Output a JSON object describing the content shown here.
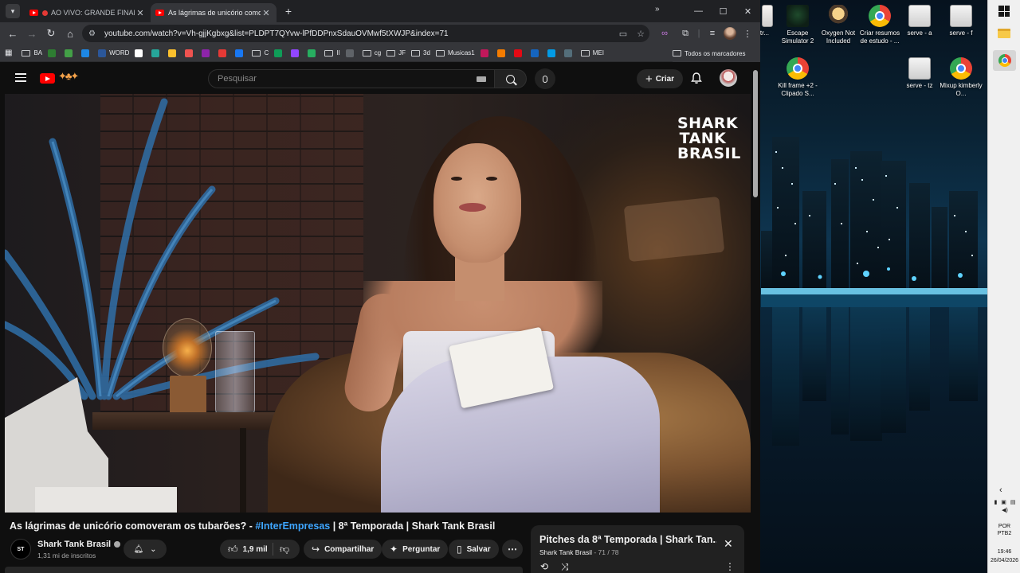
{
  "browser": {
    "tabs": [
      {
        "label": "AO VIVO: GRANDE FINAL D",
        "live": true,
        "active": false
      },
      {
        "label": "As lágrimas de unicório comove",
        "live": false,
        "active": true
      }
    ],
    "url": "youtube.com/watch?v=Vh-gjjKgbxg&list=PLDPT7QYvw-lPfDDPnxSdauOVMwf5tXWJP&index=71",
    "bookmarks": [
      {
        "label": "BA",
        "type": "folder"
      },
      {
        "label": "",
        "type": "site",
        "color": "#2e7d32"
      },
      {
        "label": "",
        "type": "site",
        "color": "#43a047"
      },
      {
        "label": "",
        "type": "site",
        "color": "#1e88e5"
      },
      {
        "label": "WORD",
        "type": "site",
        "color": "#2b579a"
      },
      {
        "label": "",
        "type": "site",
        "color": "#ffffff"
      },
      {
        "label": "",
        "type": "site",
        "color": "#26a69a"
      },
      {
        "label": "",
        "type": "site",
        "color": "#fbc02d"
      },
      {
        "label": "",
        "type": "site",
        "color": "#ef5350"
      },
      {
        "label": "",
        "type": "site",
        "color": "#8e24aa"
      },
      {
        "label": "",
        "type": "site",
        "color": "#e53935"
      },
      {
        "label": "",
        "type": "site",
        "color": "#1877f2"
      },
      {
        "label": "C",
        "type": "folder"
      },
      {
        "label": "",
        "type": "site",
        "color": "#0f9d58"
      },
      {
        "label": "",
        "type": "site",
        "color": "#9146ff"
      },
      {
        "label": "",
        "type": "site",
        "color": "#27ae60"
      },
      {
        "label": "II",
        "type": "folder"
      },
      {
        "label": "",
        "type": "site",
        "color": "#5f6368"
      },
      {
        "label": "cg",
        "type": "folder"
      },
      {
        "label": "JF",
        "type": "folder"
      },
      {
        "label": "3d",
        "type": "folder"
      },
      {
        "label": "Musicas1",
        "type": "folder"
      },
      {
        "label": "",
        "type": "site",
        "color": "#c2185b"
      },
      {
        "label": "",
        "type": "site",
        "color": "#f57c00"
      },
      {
        "label": "",
        "type": "site",
        "color": "#e50914"
      },
      {
        "label": "",
        "type": "site",
        "color": "#1565c0"
      },
      {
        "label": "",
        "type": "site",
        "color": "#039be5"
      },
      {
        "label": "",
        "type": "site",
        "color": "#546e7a"
      },
      {
        "label": "MEI",
        "type": "folder"
      }
    ],
    "all_bookmarks": "Todos os marcadores",
    "more": "»"
  },
  "youtube": {
    "search_placeholder": "Pesquisar",
    "create_label": "Criar",
    "video_overlay_logo": [
      "SHARK",
      "TANK",
      "BRASIL"
    ],
    "title_prefix": "As lágrimas de unicório comoveram os tubarões? - ",
    "title_hashtag": "#InterEmpresas",
    "title_suffix": " | 8ª Temporada | Shark Tank Brasil",
    "channel": {
      "name": "Shark Tank Brasil",
      "subscribers": "1,31 mi de inscritos",
      "avatar_text": "ST"
    },
    "actions": {
      "likes": "1,9 mil",
      "share": "Compartilhar",
      "ask": "Perguntar",
      "save": "Salvar"
    },
    "playlist": {
      "title": "Pitches da 8ª Temporada | Shark Tan...",
      "channel": "Shark Tank Brasil",
      "position": " - 71 / 78"
    }
  },
  "desktop": {
    "icons": [
      {
        "label": "d - Str...",
        "kind": "page"
      },
      {
        "label": "Escape Simulator 2",
        "kind": "escape"
      },
      {
        "label": "Oxygen Not Included",
        "kind": "oni"
      },
      {
        "label": "Criar resumos de estudo - ...",
        "kind": "chrome"
      },
      {
        "label": "serve - a",
        "kind": "page"
      },
      {
        "label": "serve - f",
        "kind": "page"
      },
      {
        "label": "Kill frame +2 - Clipado S...",
        "kind": "chrome"
      },
      {
        "label": "serve - tz",
        "kind": "page"
      },
      {
        "label": "Mixup kimberly O...",
        "kind": "chrome"
      }
    ]
  },
  "taskbar": {
    "lang": [
      "POR",
      "PTB2"
    ],
    "time": "19:46",
    "date": "26/04/2026"
  }
}
